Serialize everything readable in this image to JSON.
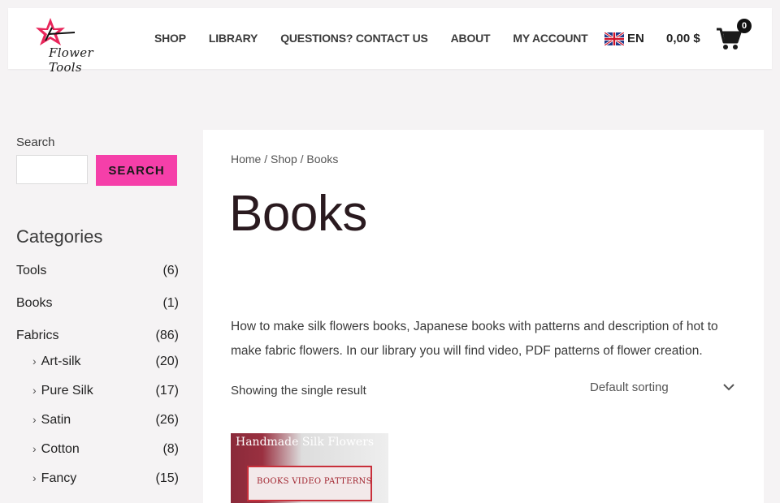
{
  "header": {
    "logo_text": "Flower Tools",
    "nav": [
      "SHOP",
      "LIBRARY",
      "QUESTIONS? CONTACT US",
      "ABOUT",
      "MY ACCOUNT"
    ],
    "language": "EN",
    "cart_total": "0,00 $",
    "cart_count": "0"
  },
  "sidebar": {
    "search_label": "Search",
    "search_value": "",
    "search_button": "SEARCH",
    "categories_title": "Categories",
    "categories": [
      {
        "label": "Tools",
        "count": "(6)"
      },
      {
        "label": "Books",
        "count": "(1)"
      },
      {
        "label": "Fabrics",
        "count": "(86)"
      }
    ],
    "subcategories": [
      {
        "label": "Art-silk",
        "count": "(20)"
      },
      {
        "label": "Pure Silk",
        "count": "(17)"
      },
      {
        "label": "Satin",
        "count": "(26)"
      },
      {
        "label": "Cotton",
        "count": "(8)"
      },
      {
        "label": "Fancy",
        "count": "(15)"
      }
    ]
  },
  "main": {
    "breadcrumb": {
      "home": "Home",
      "shop": "Shop",
      "current": "Books",
      "sep": " / "
    },
    "title": "Books",
    "description": "How to make silk flowers books, Japanese books with patterns and description of hot to make fabric flowers. In our library you will find video, PDF patterns of flower creation.",
    "result_count": "Showing the single result",
    "sorting": "Default sorting",
    "product_thumb_text1": "Handmade Silk Flowers",
    "product_thumb_text2": "BOOKS VIDEO PATTERNS"
  },
  "colors": {
    "accent": "#f53fa9",
    "background": "#f5f3f4",
    "title": "#2a1a1f"
  }
}
